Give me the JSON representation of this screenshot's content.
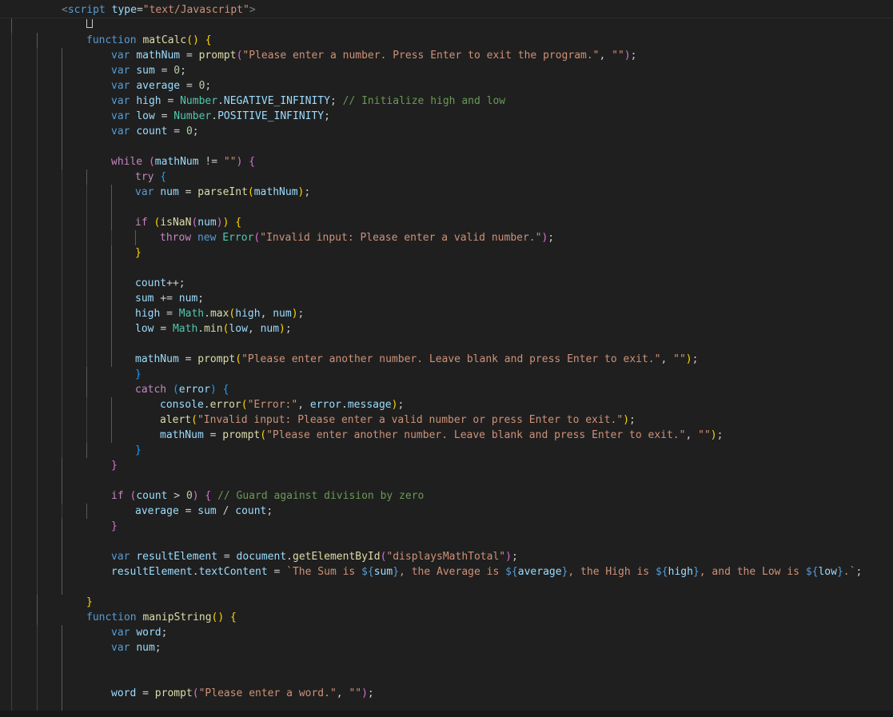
{
  "editor": {
    "language": "javascript",
    "colors": {
      "background": "#1f1f1f",
      "keyword": "#569cd6",
      "control": "#c586c0",
      "function": "#dcdcaa",
      "variable": "#9cdcfe",
      "string": "#ce9178",
      "number": "#b5cea8",
      "comment": "#6a9955",
      "class": "#4ec9b0"
    },
    "lines": [
      "<script type=\"text/Javascript\">",
      "",
      "function matCalc() {",
      "var mathNum = prompt(\"Please enter a number. Press Enter to exit the program.\", \"\");",
      "var sum = 0;",
      "var average = 0;",
      "var high = Number.NEGATIVE_INFINITY; // Initialize high and low",
      "var low = Number.POSITIVE_INFINITY;",
      "var count = 0;",
      "",
      "while (mathNum != \"\") {",
      "try {",
      "var num = parseInt(mathNum);",
      "",
      "if (isNaN(num)) {",
      "throw new Error(\"Invalid input: Please enter a valid number.\");",
      "}",
      "",
      "count++;",
      "sum += num;",
      "high = Math.max(high, num);",
      "low = Math.min(low, num);",
      "",
      "mathNum = prompt(\"Please enter another number. Leave blank and press Enter to exit.\", \"\");",
      "}",
      "catch (error) {",
      "console.error(\"Error:\", error.message);",
      "alert(\"Invalid input: Please enter a valid number or press Enter to exit.\");",
      "mathNum = prompt(\"Please enter another number. Leave blank and press Enter to exit.\", \"\");",
      "}",
      "}",
      "",
      "if (count > 0) { // Guard against division by zero",
      "average = sum / count;",
      "}",
      "",
      "var resultElement = document.getElementById(\"displaysMathTotal\");",
      "resultElement.textContent = `The Sum is ${sum}, the Average is ${average}, the High is ${high}, and the Low is ${low}.`;",
      "",
      "}",
      "function manipString() {",
      "var word;",
      "var num;",
      "",
      "",
      "word = prompt(\"Please enter a word.\", \"\");",
      ""
    ]
  }
}
